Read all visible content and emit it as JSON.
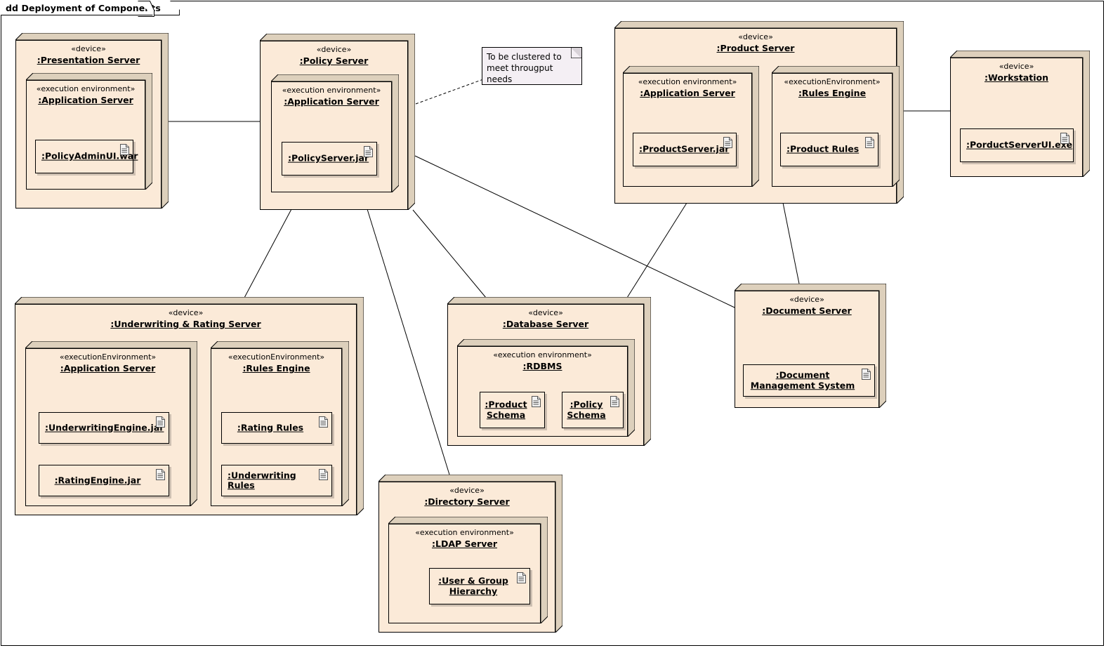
{
  "frame": {
    "title": "dd Deployment of Components"
  },
  "note": {
    "text": "To be clustered to meet througput needs",
    "icon": "note-fold-icon"
  },
  "stereotypes": {
    "device": "«device»",
    "exec_env_spaced": "«execution environment»",
    "exec_env_camel": "«executionEnvironment»"
  },
  "icons": {
    "artifact": "artifact-document-icon"
  },
  "colors": {
    "node_fill": "#fbead8",
    "node_side": "#ddd0bc",
    "note_fill": "#f4eff4",
    "stroke": "#000000"
  },
  "nodes": [
    {
      "id": "presentation-server",
      "stereotype": "«device»",
      "name": ":Presentation Server",
      "children": [
        {
          "id": "presentation-app-server",
          "stereotype": "«execution environment»",
          "name": ":Application Server",
          "artifacts": [
            {
              "id": "policyadminui-war",
              "label": ":PolicyAdminUI.war"
            }
          ]
        }
      ]
    },
    {
      "id": "policy-server",
      "stereotype": "«device»",
      "name": ":Policy Server",
      "children": [
        {
          "id": "policy-app-server",
          "stereotype": "«execution environment»",
          "name": ":Application Server",
          "artifacts": [
            {
              "id": "policyserver-jar",
              "label": ":PolicyServer.jar"
            }
          ]
        }
      ]
    },
    {
      "id": "product-server",
      "stereotype": "«device»",
      "name": ":Product Server",
      "children": [
        {
          "id": "product-app-server",
          "stereotype": "«execution environment»",
          "name": ":Application Server",
          "artifacts": [
            {
              "id": "productserver-jar",
              "label": ":ProductServer.jar"
            }
          ]
        },
        {
          "id": "product-rules-engine",
          "stereotype": "«executionEnvironment»",
          "name": ":Rules Engine",
          "artifacts": [
            {
              "id": "product-rules",
              "label": ":Product Rules"
            }
          ]
        }
      ]
    },
    {
      "id": "workstation",
      "stereotype": "«device»",
      "name": ":Workstation",
      "artifacts": [
        {
          "id": "porductserverui-exe",
          "label": ":PorductServerUI.exe"
        }
      ]
    },
    {
      "id": "underwriting-rating-server",
      "stereotype": "«device»",
      "name": ":Underwriting & Rating Server",
      "children": [
        {
          "id": "uw-app-server",
          "stereotype": "«executionEnvironment»",
          "name": ":Application Server",
          "artifacts": [
            {
              "id": "underwritingengine-jar",
              "label": ":UnderwritingEngine.jar"
            },
            {
              "id": "ratingengine-jar",
              "label": ":RatingEngine.jar"
            }
          ]
        },
        {
          "id": "uw-rules-engine",
          "stereotype": "«executionEnvironment»",
          "name": ":Rules Engine",
          "artifacts": [
            {
              "id": "rating-rules",
              "label": ":Rating Rules"
            },
            {
              "id": "underwriting-rules",
              "label": ":Underwriting Rules"
            }
          ]
        }
      ]
    },
    {
      "id": "database-server",
      "stereotype": "«device»",
      "name": ":Database Server",
      "children": [
        {
          "id": "rdbms",
          "stereotype": "«execution environment»",
          "name": ":RDBMS",
          "artifacts": [
            {
              "id": "product-schema",
              "label": ":Product Schema"
            },
            {
              "id": "policy-schema",
              "label": ":Policy Schema"
            }
          ]
        }
      ]
    },
    {
      "id": "document-server",
      "stereotype": "«device»",
      "name": ":Document Server",
      "artifacts": [
        {
          "id": "document-management-system",
          "label": ":Document Management System"
        }
      ]
    },
    {
      "id": "directory-server",
      "stereotype": "«device»",
      "name": ":Directory Server",
      "children": [
        {
          "id": "ldap-server",
          "stereotype": "«execution environment»",
          "name": ":LDAP Server",
          "artifacts": [
            {
              "id": "user-group-hierarchy",
              "label": ":User & Group Hierarchy"
            }
          ]
        }
      ]
    }
  ],
  "connections": [
    {
      "id": "presentation-to-policy",
      "from": "presentation-server",
      "to": "policy-server",
      "style": "solid"
    },
    {
      "id": "policy-to-note",
      "from": "policy-server",
      "to": "note",
      "style": "dashed"
    },
    {
      "id": "policy-to-underwriting",
      "from": "policy-server",
      "to": "underwriting-rating-server",
      "style": "solid"
    },
    {
      "id": "policy-to-directory",
      "from": "policy-server",
      "to": "directory-server",
      "style": "solid"
    },
    {
      "id": "policy-to-database",
      "from": "policy-server",
      "to": "database-server",
      "style": "solid"
    },
    {
      "id": "policy-to-document",
      "from": "policy-server",
      "to": "document-server",
      "style": "solid"
    },
    {
      "id": "product-to-database",
      "from": "product-server",
      "to": "database-server",
      "style": "solid"
    },
    {
      "id": "product-to-document",
      "from": "product-server",
      "to": "document-server",
      "style": "solid"
    },
    {
      "id": "product-to-workstation",
      "from": "product-server",
      "to": "workstation",
      "style": "solid"
    }
  ]
}
